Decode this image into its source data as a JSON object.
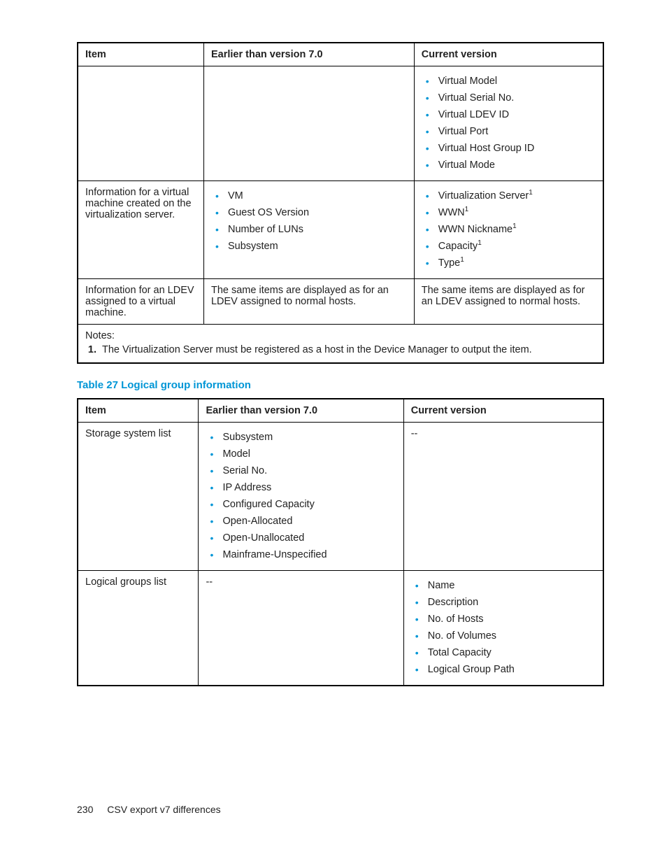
{
  "table1": {
    "headers": {
      "item": "Item",
      "earlier": "Earlier than version 7.0",
      "current": "Current version"
    },
    "rows": [
      {
        "item": "",
        "earlierText": "",
        "currentList": [
          {
            "text": "Virtual Model"
          },
          {
            "text": "Virtual Serial No."
          },
          {
            "text": "Virtual LDEV ID"
          },
          {
            "text": "Virtual Port"
          },
          {
            "text": "Virtual Host Group ID"
          },
          {
            "text": "Virtual Mode"
          }
        ]
      },
      {
        "item": "Information for a virtual machine created on the virtualization server.",
        "earlierList": [
          {
            "text": "VM"
          },
          {
            "text": "Guest OS Version"
          },
          {
            "text": "Number of LUNs"
          },
          {
            "text": "Subsystem"
          }
        ],
        "currentList": [
          {
            "text": "Virtualization Server",
            "sup": "1"
          },
          {
            "text": "WWN",
            "sup": "1"
          },
          {
            "text": "WWN Nickname",
            "sup": "1"
          },
          {
            "text": "Capacity",
            "sup": "1"
          },
          {
            "text": "Type",
            "sup": "1"
          }
        ]
      },
      {
        "item": "Information for an LDEV assigned to a virtual machine.",
        "earlierText": "The same items are displayed as for an LDEV assigned to normal hosts.",
        "currentText": "The same items are displayed as for an LDEV assigned to normal hosts."
      }
    ],
    "notesLabel": "Notes:",
    "notes": [
      "The Virtualization Server must be registered as a host in the Device Manager to output the item."
    ]
  },
  "caption2": "Table 27 Logical group information",
  "table2": {
    "headers": {
      "item": "Item",
      "earlier": "Earlier than version 7.0",
      "current": "Current version"
    },
    "rows": [
      {
        "item": "Storage system list",
        "earlierList": [
          {
            "text": "Subsystem"
          },
          {
            "text": "Model"
          },
          {
            "text": "Serial No."
          },
          {
            "text": "IP Address"
          },
          {
            "text": "Configured Capacity"
          },
          {
            "text": "Open-Allocated"
          },
          {
            "text": "Open-Unallocated"
          },
          {
            "text": "Mainframe-Unspecified"
          }
        ],
        "currentText": "--"
      },
      {
        "item": "Logical groups list",
        "earlierText": "--",
        "currentList": [
          {
            "text": "Name"
          },
          {
            "text": "Description"
          },
          {
            "text": "No. of Hosts"
          },
          {
            "text": "No. of Volumes"
          },
          {
            "text": "Total Capacity"
          },
          {
            "text": "Logical Group Path"
          }
        ]
      }
    ]
  },
  "footer": {
    "page": "230",
    "title": "CSV export v7 differences"
  }
}
